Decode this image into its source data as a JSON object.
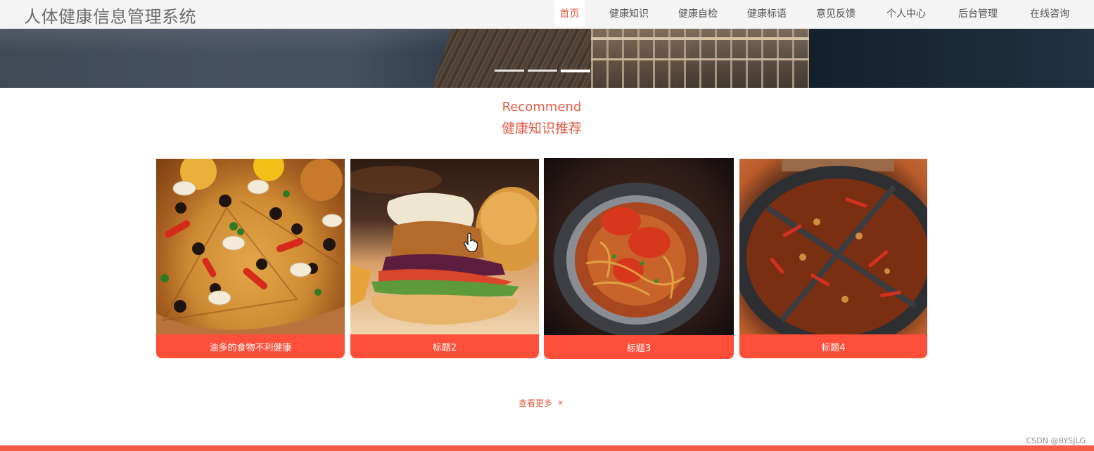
{
  "header": {
    "site_title": "人体健康信息管理系统",
    "nav": [
      {
        "label": "首页",
        "active": true
      },
      {
        "label": "健康知识",
        "active": false
      },
      {
        "label": "健康自检",
        "active": false
      },
      {
        "label": "健康标语",
        "active": false
      },
      {
        "label": "意见反馈",
        "active": false
      },
      {
        "label": "个人中心",
        "active": false
      },
      {
        "label": "后台管理",
        "active": false
      },
      {
        "label": "在线咨询",
        "active": false
      }
    ]
  },
  "carousel": {
    "slide_count": 3,
    "active_slide": 3
  },
  "section": {
    "title_en": "Recommend",
    "title_cn": "健康知识推荐"
  },
  "cards": [
    {
      "caption": "油多的食物不利健康",
      "image": "pizza"
    },
    {
      "caption": "标题2",
      "image": "burger"
    },
    {
      "caption": "标题3",
      "image": "crab-dry-pot"
    },
    {
      "caption": "标题4",
      "image": "hotpot"
    }
  ],
  "more": {
    "label": "查看更多",
    "icon": "double-chevron-right-icon"
  },
  "watermark": "CSDN @BYSJLG",
  "colors": {
    "accent": "#e15b43",
    "caption_bg": "#fd4f3a",
    "header_bg": "#f4f4f4"
  }
}
